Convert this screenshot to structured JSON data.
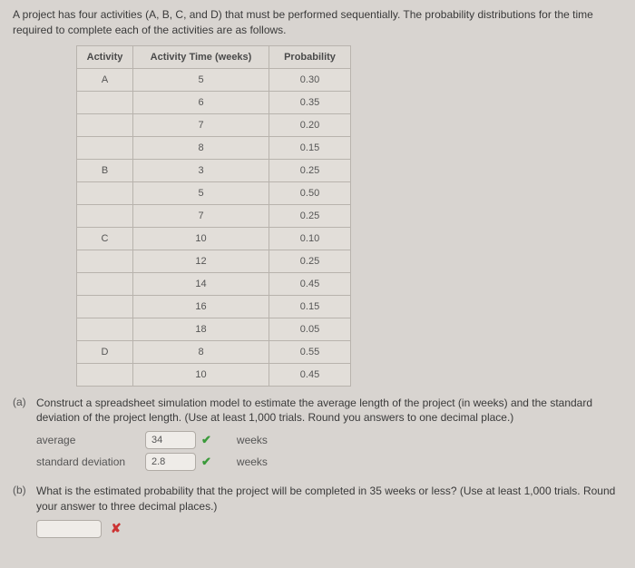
{
  "intro": "A project has four activities (A, B, C, and D) that must be performed sequentially. The probability distributions for the time required to complete each of the activities are as follows.",
  "table": {
    "headers": {
      "activity": "Activity",
      "time": "Activity Time (weeks)",
      "prob": "Probability"
    },
    "rows": [
      {
        "activity": "A",
        "time": "5",
        "prob": "0.30"
      },
      {
        "activity": "",
        "time": "6",
        "prob": "0.35"
      },
      {
        "activity": "",
        "time": "7",
        "prob": "0.20"
      },
      {
        "activity": "",
        "time": "8",
        "prob": "0.15"
      },
      {
        "activity": "B",
        "time": "3",
        "prob": "0.25"
      },
      {
        "activity": "",
        "time": "5",
        "prob": "0.50"
      },
      {
        "activity": "",
        "time": "7",
        "prob": "0.25"
      },
      {
        "activity": "C",
        "time": "10",
        "prob": "0.10"
      },
      {
        "activity": "",
        "time": "12",
        "prob": "0.25"
      },
      {
        "activity": "",
        "time": "14",
        "prob": "0.45"
      },
      {
        "activity": "",
        "time": "16",
        "prob": "0.15"
      },
      {
        "activity": "",
        "time": "18",
        "prob": "0.05"
      },
      {
        "activity": "D",
        "time": "8",
        "prob": "0.55"
      },
      {
        "activity": "",
        "time": "10",
        "prob": "0.45"
      }
    ]
  },
  "a": {
    "label": "(a)",
    "text": "Construct a spreadsheet simulation model to estimate the average length of the project (in weeks) and the standard deviation of the project length. (Use at least 1,000 trials. Round you answers to one decimal place.)",
    "average_label": "average",
    "average_value": "34",
    "std_label": "standard deviation",
    "std_value": "2.8",
    "unit": "weeks"
  },
  "b": {
    "label": "(b)",
    "text": "What is the estimated probability that the project will be completed in 35 weeks or less? (Use at least 1,000 trials. Round your answer to three decimal places.)",
    "value": ""
  }
}
